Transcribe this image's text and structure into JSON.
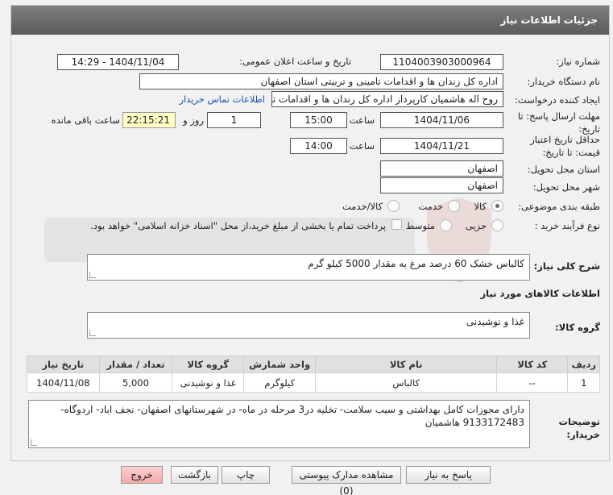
{
  "header": {
    "title": "جزئیات اطلاعات نیاز"
  },
  "fields": {
    "need_number_label": "شماره نیاز:",
    "need_number": "1104003903000964",
    "announce_label": "تاریخ و ساعت اعلان عمومی:",
    "announce_value": "1404/11/04 - 14:29",
    "buyer_org_label": "نام دستگاه خریدار:",
    "buyer_org": "اداره کل زندان ها و اقدامات تامینی و تربیتی استان اصفهان",
    "requester_label": "ایجاد کننده درخواست:",
    "requester": "روح اله هاشمیان کارپرداز اداره کل زندان ها و اقدامات تامینی و تربیتی استان اصفهان",
    "contact_link": "اطلاعات تماس خریدار",
    "send_deadline_label": "مهلت ارسال پاسخ: تا تاریخ:",
    "send_deadline_date": "1404/11/06",
    "time_label": "ساعت",
    "send_deadline_time": "15:00",
    "days_value": "1",
    "day_and_label": "روز و",
    "remaining_time": "22:15:21",
    "remaining_label": "ساعت باقی مانده",
    "price_validity_label": "حداقل تاریخ اعتبار قیمت: تا تاریخ:",
    "price_validity_date": "1404/11/21",
    "price_validity_time": "14:00",
    "province_label": "استان محل تحویل:",
    "province": "اصفهان",
    "city_label": "شهر محل تحویل:",
    "city": "اصفهان",
    "category_label": "طبقه بندی موضوعی:",
    "category_options": [
      "کالا",
      "خدمت",
      "کالا/خدمت"
    ],
    "process_label": "نوع فرآیند خرید :",
    "process_options": [
      "جزیی",
      "متوسط"
    ],
    "payment_note": "پرداخت تمام یا بخشی از مبلغ خرید،از محل \"اسناد خزانه اسلامی\" خواهد بود."
  },
  "description": {
    "label": "شرح کلی نیاز:",
    "value": "کالباس خشک 60 درصد مرغ به مقدار 5000 کیلو گرم"
  },
  "goods_section_title": "اطلاعات کالاهای مورد نیاز",
  "goods_group": {
    "label": "گروه کالا:",
    "value": "غذا و نوشیدنی"
  },
  "table": {
    "headers": [
      "ردیف",
      "کد کالا",
      "نام کالا",
      "واحد شمارش",
      "گروه کالا",
      "تعداد / مقدار",
      "تاریخ نیاز"
    ],
    "rows": [
      [
        "1",
        "--",
        "کالباس",
        "کیلوگرم",
        "غذا و نوشیدنی",
        "5,000",
        "1404/11/08"
      ]
    ]
  },
  "buyer_notes": {
    "label": "توضیحات خریدار:",
    "value": "دارای مجوزات کامل بهداشتی و سیب سلامت- تخلیه در3  مرحله در ماه- در شهرستانهای اصفهان- نجف اباد- اردوگاه- 9133172483 هاشمیان"
  },
  "buttons": {
    "reply": "پاسخ به نیاز",
    "attachments": "مشاهده مدارک پیوستی (0)",
    "print": "چاپ",
    "back": "بازگشت",
    "exit": "خروج"
  },
  "watermark_icon": "shield-logo-icon",
  "colors": {
    "header": "#6a6a6a",
    "link": "#1a4fb5",
    "highlight": "#ffffc6",
    "exit_button": "#f5b5b5"
  }
}
